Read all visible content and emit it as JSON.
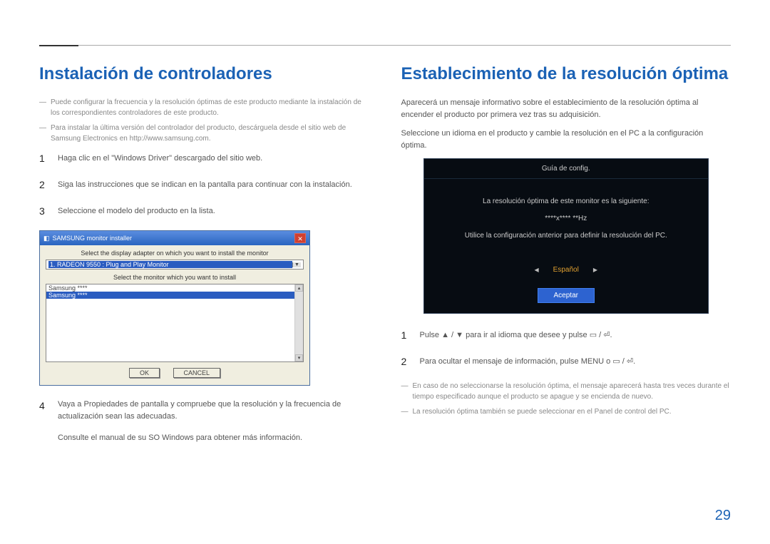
{
  "pageNumber": "29",
  "left": {
    "heading": "Instalación de controladores",
    "notes": [
      "Puede configurar la frecuencia y la resolución óptimas de este producto mediante la instalación de los correspondientes controladores de este producto.",
      "Para instalar la última versión del controlador del producto, descárguela desde el sitio web de Samsung Electronics en http://www.samsung.com."
    ],
    "steps": [
      "Haga clic en el \"Windows Driver\" descargado del sitio web.",
      "Siga las instrucciones que se indican en la pantalla para continuar con la instalación.",
      "Seleccione el modelo del producto en la lista."
    ],
    "dialog": {
      "title": "SAMSUNG monitor installer",
      "label1": "Select the display adapter on which you want to install the monitor",
      "comboValue": "1. RADEON 9550 : Plug and Play Monitor",
      "label2": "Select the monitor which you want to install",
      "listItems": [
        "Samsung ****",
        "Samsung ****"
      ],
      "okBtn": "OK",
      "cancelBtn": "CANCEL"
    },
    "step4": "Vaya a Propiedades de pantalla y compruebe que la resolución y la frecuencia de actualización sean las adecuadas.",
    "step4Extra": "Consulte el manual de su SO Windows para obtener más información."
  },
  "right": {
    "heading": "Establecimiento de la resolución óptima",
    "intro1": "Aparecerá un mensaje informativo sobre el establecimiento de la resolución óptima al encender el producto por primera vez tras su adquisición.",
    "intro2": "Seleccione un idioma en el producto y cambie la resolución en el PC a la configuración óptima.",
    "osd": {
      "title": "Guía de config.",
      "line1": "La resolución óptima de este monitor es la siguiente:",
      "line2": "****x**** **Hz",
      "line3": "Utilice la configuración anterior para definir la resolución del PC.",
      "lang": "Español",
      "button": "Aceptar"
    },
    "steps": [
      "Pulse ▲ / ▼ para ir al idioma que desee y pulse ▭ / ⏎.",
      "Para ocultar el mensaje de información, pulse MENU o ▭ / ⏎."
    ],
    "notes": [
      "En caso de no seleccionarse la resolución óptima, el mensaje aparecerá hasta tres veces durante el tiempo especificado aunque el producto se apague y se encienda de nuevo.",
      "La resolución óptima también se puede seleccionar en el Panel de control del PC."
    ]
  }
}
